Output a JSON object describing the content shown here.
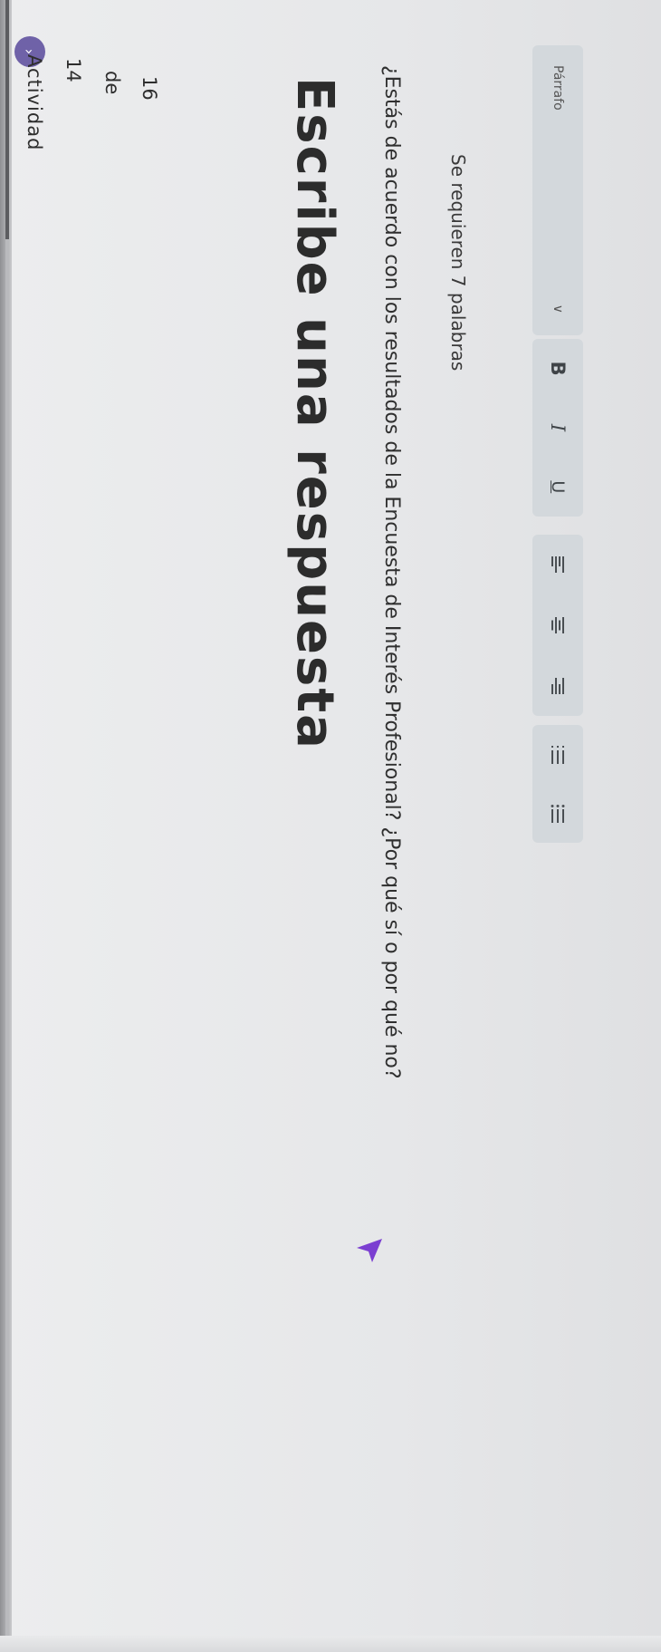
{
  "activity": {
    "label": "Actividad",
    "current": "14",
    "of_label": "de",
    "total": "16",
    "next_icon": "chevron-right-icon",
    "progress": 0.145
  },
  "title": "Escribe una respuesta",
  "question": "¿Estás de acuerdo con los resultados de la Encuesta de Interés Profesional? ¿Por qué sí o por qué no?",
  "requirement": "Se requieren 7 palabras",
  "toolbar": {
    "paragraph_label": "Párrafo",
    "bold": "B",
    "italic": "I",
    "underline": "U"
  },
  "colors": {
    "accent": "#6f62a8",
    "pointer": "#7b3fd1",
    "toolbar_bg": "#d3d8dc",
    "text": "#2c2c2c"
  }
}
